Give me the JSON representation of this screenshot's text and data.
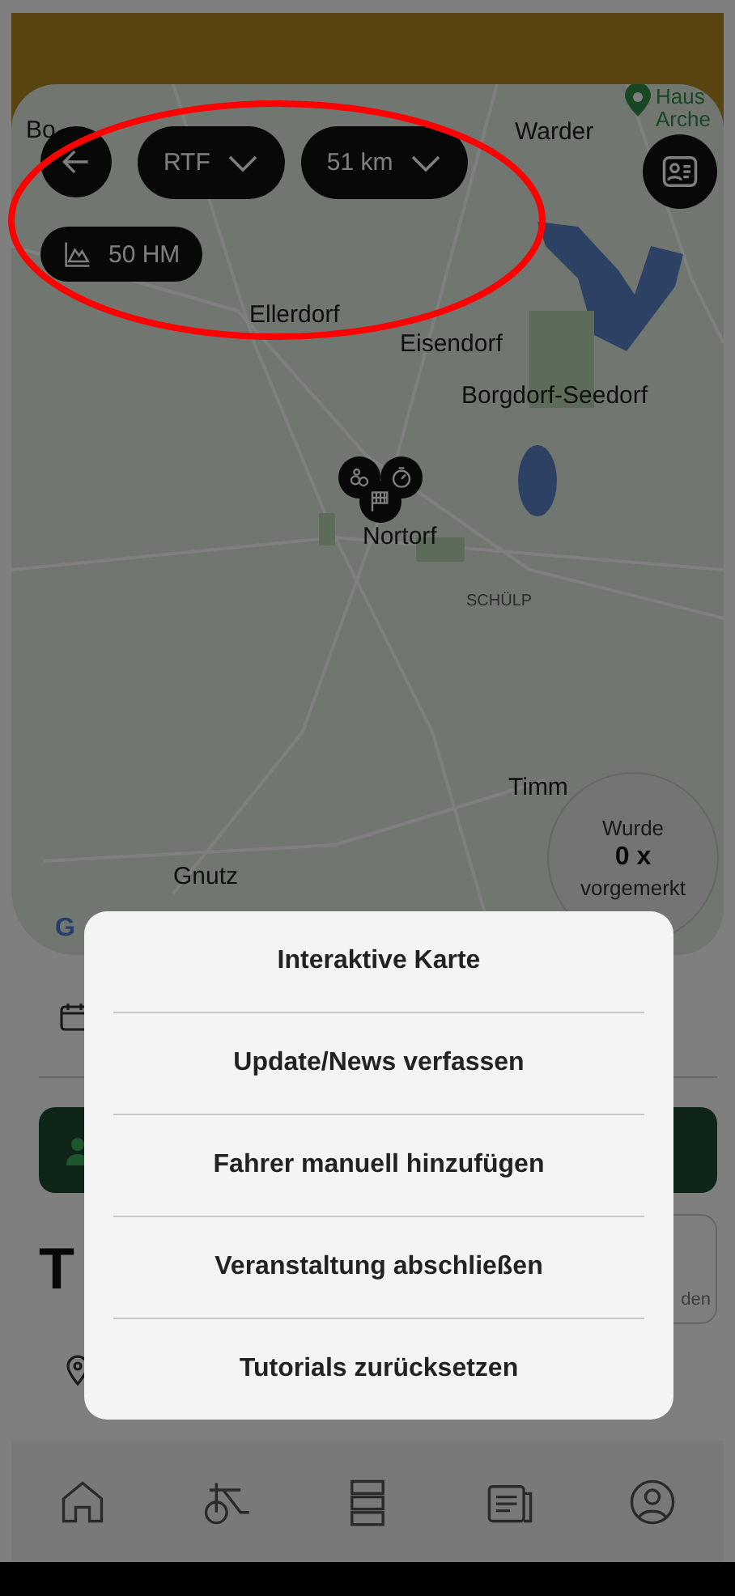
{
  "map": {
    "labels": [
      {
        "kind": "poi",
        "text": "Haus"
      },
      {
        "kind": "town",
        "text": "Bo"
      },
      {
        "kind": "town",
        "text": "Warder"
      },
      {
        "kind": "poi-line",
        "text": "Arche"
      },
      {
        "kind": "town",
        "text": "Ellerdorf"
      },
      {
        "kind": "town",
        "text": "Eisendorf"
      },
      {
        "kind": "town",
        "text": "Borgdorf-Seedorf"
      },
      {
        "kind": "town",
        "text": "Nortorf"
      },
      {
        "kind": "district",
        "text": "SCHÜLP"
      },
      {
        "kind": "town",
        "text": "Timm"
      },
      {
        "kind": "town",
        "text": "Gnutz"
      },
      {
        "kind": "logo",
        "text": "G"
      }
    ],
    "filters": [
      {
        "kind": "dropdown",
        "label": "RTF"
      },
      {
        "kind": "dropdown",
        "label": "51 km"
      },
      {
        "kind": "elevation",
        "label": "50 HM"
      }
    ],
    "markers": [
      {
        "kind": "bike"
      },
      {
        "kind": "speed"
      },
      {
        "kind": "finish"
      }
    ],
    "bookmark_badge": {
      "line1": "Wurde",
      "count": "0 x",
      "line2": "vorgemerkt"
    }
  },
  "event": {
    "title": "T",
    "card_text": "den"
  },
  "menu": {
    "items": [
      "Interaktive Karte",
      "Update/News verfassen",
      "Fahrer manuell hinzufügen",
      "Veranstaltung abschließen",
      "Tutorials zurücksetzen"
    ]
  },
  "nav": [
    {
      "kind": "home"
    },
    {
      "kind": "bike"
    },
    {
      "kind": "server"
    },
    {
      "kind": "news"
    },
    {
      "kind": "profile"
    }
  ],
  "annotation": {
    "kind": "ellipse"
  }
}
